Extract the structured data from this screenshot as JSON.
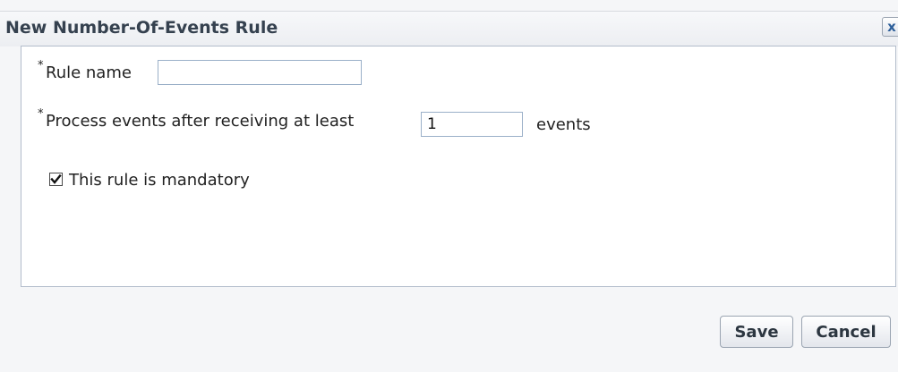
{
  "dialog": {
    "title": "New Number-Of-Events Rule",
    "close_label": "x"
  },
  "form": {
    "required_marker": "*",
    "rule_name_label": "Rule name",
    "rule_name_value": "",
    "process_label": "Process events after receiving at least",
    "events_count_value": "1",
    "events_suffix": "events",
    "mandatory_label": "This rule is mandatory",
    "mandatory_checked": true
  },
  "buttons": {
    "save_label": "Save",
    "cancel_label": "Cancel"
  }
}
